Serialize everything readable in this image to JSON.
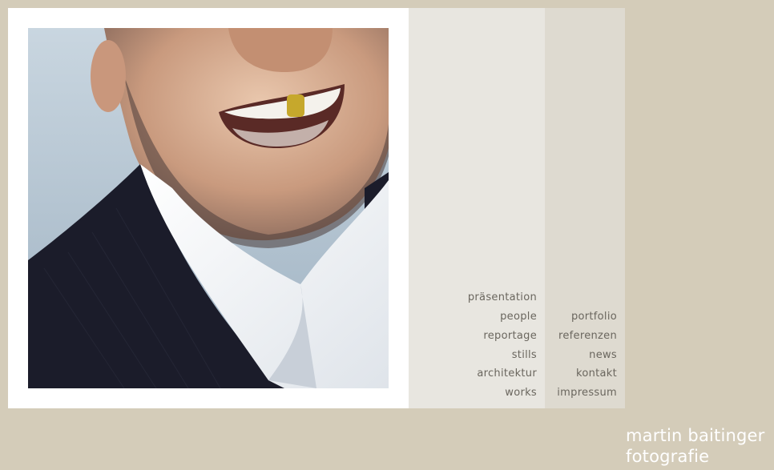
{
  "nav_primary": [
    "präsentation",
    "people",
    "reportage",
    "stills",
    "architektur",
    "works"
  ],
  "nav_secondary": [
    "portfolio",
    "referenzen",
    "news",
    "kontakt",
    "impressum"
  ],
  "brand": {
    "name": "martin baitinger",
    "tagline": "fotografie"
  },
  "colors": {
    "background": "#d4ccb9",
    "frame": "#ffffff",
    "column_light": "#e8e6e0",
    "column_mid": "#dedad0",
    "nav_text": "#6a665e",
    "brand_text": "#ffffff"
  }
}
